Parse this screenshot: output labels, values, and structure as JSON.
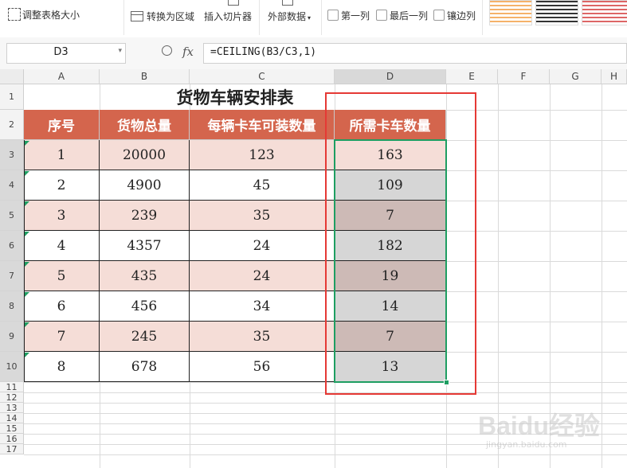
{
  "ribbon": {
    "adjust_table_size": "调整表格大小",
    "convert_to_range": "转换为区域",
    "insert_slicer": "插入切片器",
    "external_data": "外部数据",
    "first_column": "第一列",
    "last_column": "最后一列",
    "banded_columns": "镶边列"
  },
  "formula_bar": {
    "name_box": "D3",
    "fx_label": "fx",
    "formula": "=CEILING(B3/C3,1)"
  },
  "columns": [
    "A",
    "B",
    "C",
    "D",
    "E",
    "F",
    "G",
    "H"
  ],
  "rows": [
    "1",
    "2",
    "3",
    "4",
    "5",
    "6",
    "7",
    "8",
    "9",
    "10",
    "11",
    "12",
    "13",
    "14",
    "15",
    "16",
    "17"
  ],
  "sheet": {
    "title": "货物车辆安排表",
    "headers": [
      "序号",
      "货物总量",
      "每辆卡车可装数量",
      "所需卡车数量"
    ],
    "data": [
      [
        "1",
        "20000",
        "123",
        "163"
      ],
      [
        "2",
        "4900",
        "45",
        "109"
      ],
      [
        "3",
        "239",
        "35",
        "7"
      ],
      [
        "4",
        "4357",
        "24",
        "182"
      ],
      [
        "5",
        "435",
        "24",
        "19"
      ],
      [
        "6",
        "456",
        "34",
        "14"
      ],
      [
        "7",
        "245",
        "35",
        "7"
      ],
      [
        "8",
        "678",
        "56",
        "13"
      ]
    ]
  },
  "colors": {
    "header_fill": "#d4654d",
    "band_fill": "#f5ddd7",
    "selection": "#1e9e62",
    "annotation_box": "#e53935",
    "selected_gray": "#d6d6d6",
    "selected_band": "#cdbab6"
  },
  "watermark": {
    "text": "Baidu经验",
    "url": "jingyan.baidu.com"
  }
}
